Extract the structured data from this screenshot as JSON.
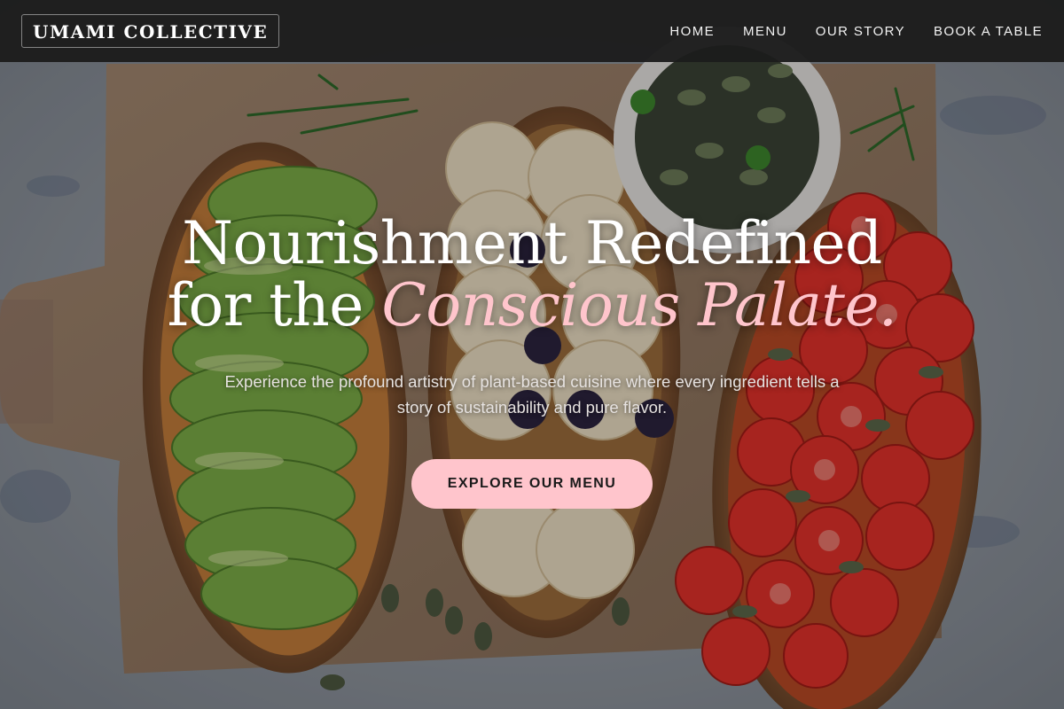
{
  "brand": {
    "name": "UMAMI COLLECTIVE"
  },
  "nav": {
    "items": [
      {
        "label": "HOME"
      },
      {
        "label": "MENU"
      },
      {
        "label": "OUR STORY"
      },
      {
        "label": "BOOK A TABLE"
      }
    ]
  },
  "hero": {
    "headline_line1": "Nourishment Redefined",
    "headline_line2_prefix": "for the ",
    "headline_line2_accent": "Conscious Palate.",
    "subtitle": "Experience the profound artistry of plant-based cuisine where every ingredient tells a story of sustainability and pure flavor.",
    "cta_label": "EXPLORE OUR MENU"
  },
  "colors": {
    "accent_pink": "#ffc5cc",
    "nav_background": "#1c1c1c",
    "text_white": "#ffffff"
  }
}
